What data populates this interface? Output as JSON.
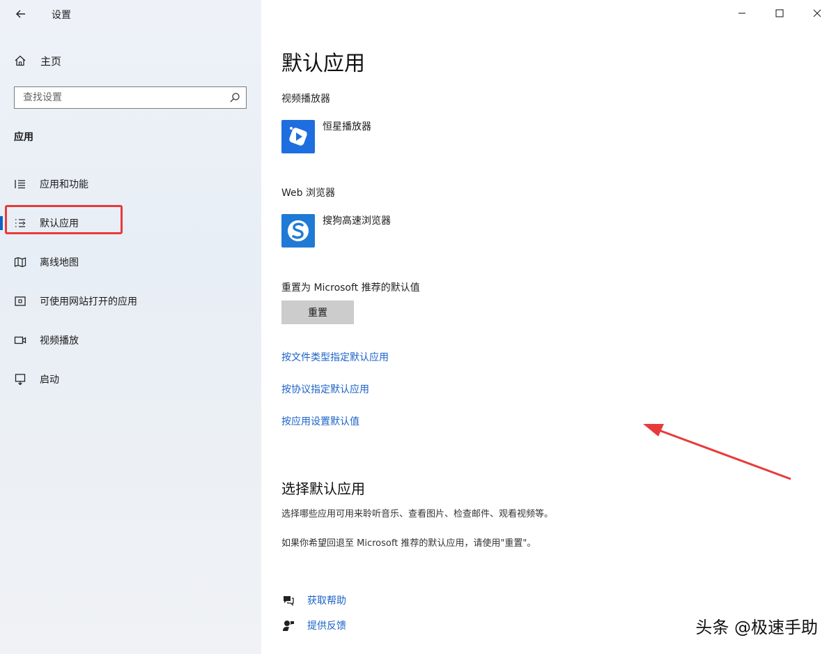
{
  "window": {
    "title": "设置"
  },
  "sidebar": {
    "home_label": "主页",
    "search_placeholder": "查找设置",
    "section_label": "应用",
    "items": [
      {
        "label": "应用和功能",
        "icon": "apps-features-icon"
      },
      {
        "label": "默认应用",
        "icon": "default-apps-icon",
        "selected": true
      },
      {
        "label": "离线地图",
        "icon": "offline-maps-icon"
      },
      {
        "label": "可使用网站打开的应用",
        "icon": "apps-for-websites-icon"
      },
      {
        "label": "视频播放",
        "icon": "video-playback-icon"
      },
      {
        "label": "启动",
        "icon": "startup-icon"
      }
    ]
  },
  "main": {
    "title": "默认应用",
    "video_player": {
      "heading": "视频播放器",
      "app_name": "恒星播放器"
    },
    "web_browser": {
      "heading": "Web 浏览器",
      "app_name": "搜狗高速浏览器"
    },
    "reset": {
      "heading": "重置为 Microsoft 推荐的默认值",
      "button_label": "重置"
    },
    "links": [
      "按文件类型指定默认应用",
      "按协议指定默认应用",
      "按应用设置默认值"
    ],
    "choose": {
      "title": "选择默认应用",
      "para1": "选择哪些应用可用来聆听音乐、查看图片、检查邮件、观看视频等。",
      "para2": "如果你希望回退至 Microsoft 推荐的默认应用，请使用\"重置\"。"
    },
    "help": {
      "get_help": "获取帮助",
      "feedback": "提供反馈"
    }
  },
  "watermark": "头条 @极速手助",
  "colors": {
    "accent": "#0a64c8",
    "link": "#1b63c8",
    "annotation": "#e83a3a"
  }
}
